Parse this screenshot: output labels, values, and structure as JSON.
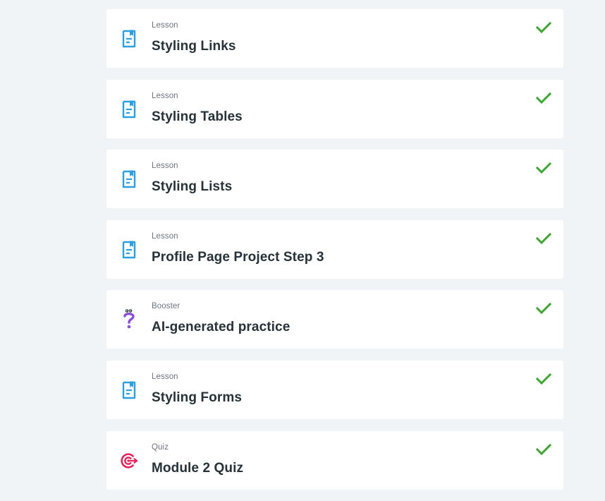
{
  "colors": {
    "background": "#f1f4f7",
    "card": "#ffffff",
    "lesson_icon": "#2b9fe0",
    "booster_icon": "#8a4fd8",
    "quiz_icon": "#e0245e",
    "check": "#3fa535",
    "title_text": "#263238",
    "type_text": "#6b7480"
  },
  "items": [
    {
      "type": "Lesson",
      "title": "Styling Links",
      "icon": "lesson-document-icon",
      "completed": true
    },
    {
      "type": "Lesson",
      "title": "Styling Tables",
      "icon": "lesson-document-icon",
      "completed": true
    },
    {
      "type": "Lesson",
      "title": "Styling Lists",
      "icon": "lesson-document-icon",
      "completed": true
    },
    {
      "type": "Lesson",
      "title": "Profile Page Project Step 3",
      "icon": "lesson-document-icon",
      "completed": true
    },
    {
      "type": "Booster",
      "title": "AI-generated practice",
      "icon": "booster-question-icon",
      "completed": true
    },
    {
      "type": "Lesson",
      "title": "Styling Forms",
      "icon": "lesson-document-icon",
      "completed": true
    },
    {
      "type": "Quiz",
      "title": "Module 2 Quiz",
      "icon": "quiz-target-icon",
      "completed": true
    }
  ]
}
